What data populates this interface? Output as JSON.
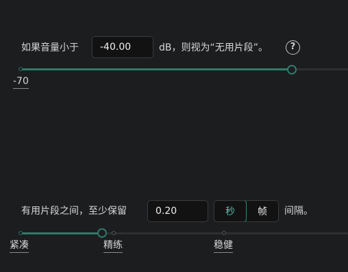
{
  "silence": {
    "prefix": "如果音量小于",
    "value": "-40.00",
    "suffix": "dB，则视为“无用片段”。",
    "help_glyph": "?",
    "slider": {
      "min_label": "-70",
      "value_fraction": 0.82
    }
  },
  "keep": {
    "prefix": "有用片段之间，至少保留",
    "value": "0.20",
    "units": {
      "options": [
        "秒",
        "帧"
      ],
      "selected": "秒"
    },
    "suffix": "间隔。",
    "slider": {
      "labels": [
        "紧凑",
        "精练",
        "稳健"
      ],
      "selected": "精练"
    }
  },
  "colors": {
    "accent": "#2f7a6b",
    "accent_text": "#4fc3a8",
    "track_inactive": "#2e2f31",
    "background": "#1c1d1f"
  }
}
